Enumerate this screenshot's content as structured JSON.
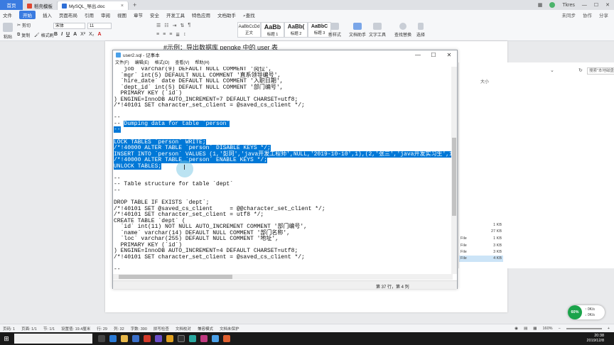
{
  "wps": {
    "home_tab": "首页",
    "tabs": [
      {
        "label": "稻壳模板",
        "color": "#e0462f"
      },
      {
        "label": "MySQL_导出.doc",
        "color": "#2f6fd6"
      }
    ],
    "user": "Tkres",
    "menu": [
      "文件",
      "开始",
      "插入",
      "页面布局",
      "引用",
      "审阅",
      "视图",
      "章节",
      "安全",
      "开发工具",
      "特色应用",
      "文档助手",
      "查找"
    ],
    "active_menu": "开始",
    "menu_right": [
      "未同步",
      "协作",
      "分享"
    ],
    "ribbon": {
      "paste": "粘贴",
      "cut": "剪切",
      "copy": "复制",
      "format_painter": "格式刷",
      "font_name": "宋体",
      "font_size": "11",
      "format_buttons": [
        "B",
        "I",
        "U",
        "A",
        "X²",
        "X₂",
        "A"
      ],
      "styles": [
        {
          "sample": "AaBbCcDd",
          "label": "正文"
        },
        {
          "sample": "AaBb",
          "label": "标题 1"
        },
        {
          "sample": "AaBb(",
          "label": "标题 2"
        },
        {
          "sample": "AaBbC",
          "label": "标题 3"
        }
      ],
      "new_style": "新样式",
      "doc_assistant": "文档助手",
      "text_tools": "文字工具",
      "find_replace": "查找替换",
      "select": "选择"
    }
  },
  "document": {
    "heading": "#示例：导出数据库 pengke 中的 user 表"
  },
  "explorer": {
    "search_placeholder": "搜索\"本地磁盘",
    "size_header": "大小",
    "sizes": [
      "1 KB",
      "27 KB",
      "1 KB",
      "3 KB",
      "3 KB",
      "4 KB"
    ],
    "file_labels": [
      "File",
      "File",
      "File",
      "File"
    ]
  },
  "notepad": {
    "title": "user2.sql - 记事本",
    "menu": [
      "文件(F)",
      "编辑(E)",
      "格式(O)",
      "查看(V)",
      "帮助(H)"
    ],
    "lines": [
      {
        "text": "  `job` varchar(9) DEFAULT NULL COMMENT '岗位',"
      },
      {
        "text": "  `mgr` int(5) DEFAULT NULL COMMENT '直系领导编号',"
      },
      {
        "text": "  `hire_date` date DEFAULT NULL COMMENT '入职日期',"
      },
      {
        "text": "  `dept_id` int(5) DEFAULT NULL COMMENT '部门编号',"
      },
      {
        "text": "  PRIMARY KEY (`id`)"
      },
      {
        "text": ") ENGINE=InnoDB AUTO_INCREMENT=7 DEFAULT CHARSET=utf8;"
      },
      {
        "text": "/*!40101 SET character_set_client = @saved_cs_client */;"
      },
      {
        "text": ""
      },
      {
        "text": "--"
      },
      {
        "text": "-- ",
        "sel": "Dumping data for table `person`"
      },
      {
        "text": "",
        "sel": "--"
      },
      {
        "text": ""
      },
      {
        "text": "",
        "sel": "LOCK TABLES `person` WRITE;"
      },
      {
        "text": "",
        "sel": "/*!40000 ALTER TABLE `person` DISABLE KEYS */;"
      },
      {
        "text": "",
        "sel": "INSERT INTO `person` VALUES (1,'彭珂','java开发工程师',NULL,'2019-10-10',1),(2,'张三','java开发实习生',1,'2019"
      },
      {
        "text": "",
        "sel": "/*!40000 ALTER TABLE `person` ENABLE KEYS */;"
      },
      {
        "text": "",
        "sel": "UNLOCK TABLES;"
      },
      {
        "text": ""
      },
      {
        "text": "--"
      },
      {
        "text": "-- Table structure for table `dept`"
      },
      {
        "text": "--"
      },
      {
        "text": ""
      },
      {
        "text": "DROP TABLE IF EXISTS `dept`;"
      },
      {
        "text": "/*!40101 SET @saved_cs_client     = @@character_set_client */;"
      },
      {
        "text": "/*!40101 SET character_set_client = utf8 */;"
      },
      {
        "text": "CREATE TABLE `dept` ("
      },
      {
        "text": "  `id` int(11) NOT NULL AUTO_INCREMENT COMMENT '部门编号',"
      },
      {
        "text": "  `name` varchar(14) DEFAULT NULL COMMENT '部门名称',"
      },
      {
        "text": "  `loc` varchar(255) DEFAULT NULL COMMENT '地址',"
      },
      {
        "text": "  PRIMARY KEY (`id`)"
      },
      {
        "text": ") ENGINE=InnoDB AUTO_INCREMENT=4 DEFAULT CHARSET=utf8;"
      },
      {
        "text": "/*!40101 SET character_set_client = @saved_cs_client */;"
      },
      {
        "text": ""
      },
      {
        "text": "--"
      }
    ],
    "status_position": "第 37 行，第 4 列"
  },
  "statusbar": {
    "items": [
      "页码: 1",
      "页面: 1/1",
      "节: 1/1",
      "设置值: 19.4厘米",
      "行: 29",
      "列: 32",
      "字数: 390",
      "拼写检查",
      "文档校对",
      "兼容模式",
      "文档未保护"
    ],
    "zoom": "160%"
  },
  "speed_widget": {
    "percent": "60%",
    "up": "0K/s",
    "down": "0K/s"
  },
  "taskbar": {
    "time": "20:38",
    "date": "2019/12/8"
  }
}
